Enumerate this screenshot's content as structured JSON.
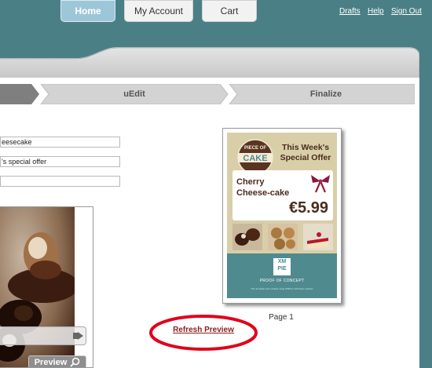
{
  "nav": {
    "home": "Home",
    "account": "My Account",
    "cart": "Cart",
    "links": [
      "Drafts",
      "Help",
      "Sign Out"
    ]
  },
  "steps": {
    "uedit": "uEdit",
    "finalize": "Finalize"
  },
  "fields": {
    "product": "eesecake",
    "headline": "'s special offer",
    "extra": ""
  },
  "image_button": "Preview",
  "preview": {
    "brand_top": "PIECE OF",
    "brand_main": "CAKE",
    "headline": "This Week's Special Offer",
    "product": "Cherry Cheese-cake",
    "price": "€5.99",
    "footer_logo_top": "XM",
    "footer_logo_bottom": "PIE",
    "footer_caption": "PROOF OF CONCEPT",
    "footer_small": "This template was created using XMPie's uProduce solution"
  },
  "page_label": "Page 1",
  "refresh": "Refresh Preview",
  "colors": {
    "background": "#4b7f86",
    "home_tab": "#9cc7d9",
    "card_beige": "#d8cfa9",
    "card_teal": "#4f8a8f",
    "price_brown": "#4a2c1c",
    "refresh_link": "#8a1e1e",
    "highlight_ellipse": "#e0001b"
  }
}
